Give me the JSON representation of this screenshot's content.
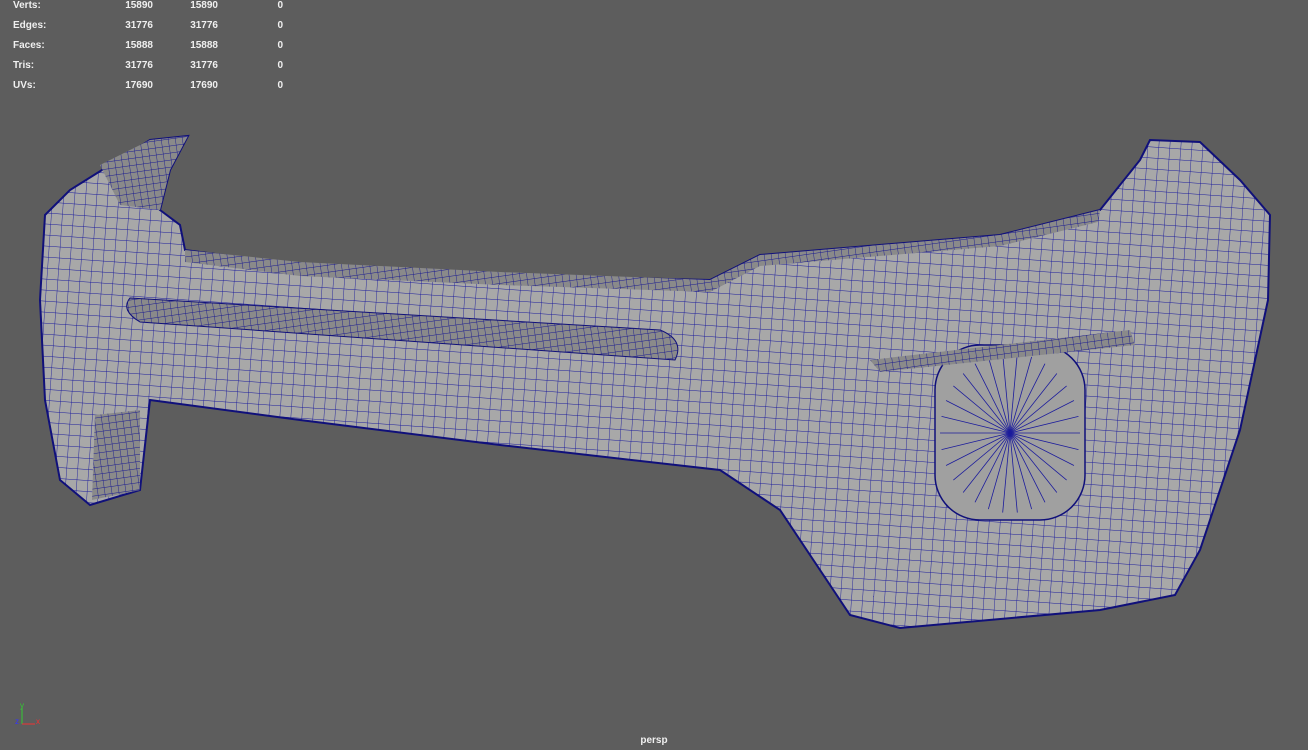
{
  "hud": {
    "rows": [
      {
        "label": "Verts:",
        "a": "15890",
        "b": "15890",
        "c": "0"
      },
      {
        "label": "Edges:",
        "a": "31776",
        "b": "31776",
        "c": "0"
      },
      {
        "label": "Faces:",
        "a": "15888",
        "b": "15888",
        "c": "0"
      },
      {
        "label": "Tris:",
        "a": "31776",
        "b": "31776",
        "c": "0"
      },
      {
        "label": "UVs:",
        "a": "17690",
        "b": "17690",
        "c": "0"
      }
    ]
  },
  "camera": "persp",
  "axis": {
    "x": "x",
    "y": "y",
    "z": "z"
  },
  "colors": {
    "background": "#5d5d5d",
    "wire": "#1a1a9a",
    "mesh": "#a6a6a6"
  }
}
